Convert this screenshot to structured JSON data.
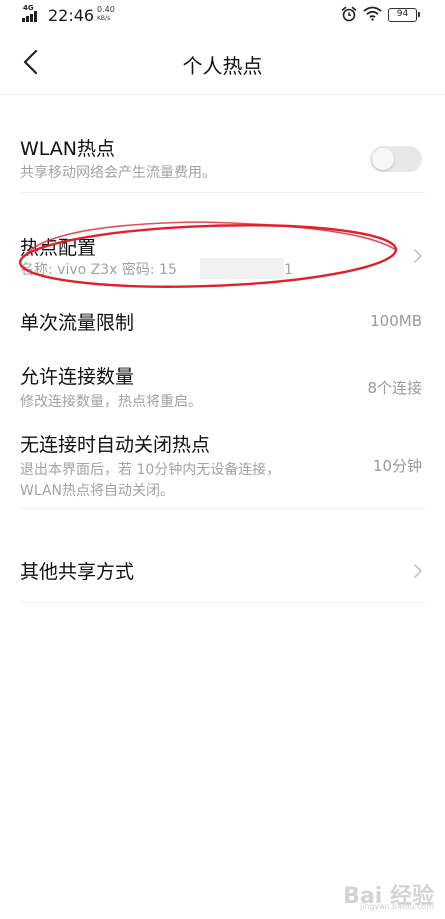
{
  "status_bar": {
    "network": "4G",
    "time": "22:46",
    "speed_value": "0.40",
    "speed_unit": "KB/s",
    "battery": "94",
    "icons": [
      "signal-icon",
      "alarm-icon",
      "wifi-icon",
      "battery-icon"
    ]
  },
  "header": {
    "title": "个人热点",
    "back_icon": "chevron-left-icon"
  },
  "wlan_hotspot": {
    "title": "WLAN热点",
    "subtitle": "共享移动网络会产生流量费用。",
    "enabled": false
  },
  "hotspot_config": {
    "title": "热点配置",
    "name_label": "名称: vivo Z3x  密码: 15",
    "password_tail": "1"
  },
  "data_limit": {
    "title": "单次流量限制",
    "value": "100MB"
  },
  "max_connections": {
    "title": "允许连接数量",
    "subtitle": "修改连接数量，热点将重启。",
    "value": "8个连接"
  },
  "auto_off": {
    "title": "无连接时自动关闭热点",
    "subtitle_line1": "退出本界面后，若 10分钟内无设备连接，",
    "subtitle_line2": "WLAN热点将自动关闭。",
    "value": "10分钟"
  },
  "other_share": {
    "title": "其他共享方式"
  },
  "colors": {
    "annotation_red": "#e0202a",
    "divider": "#efefef",
    "secondary_text": "#a2a2a2"
  },
  "watermark": {
    "text": "Bai 经验",
    "sub": "jingyan.baidu.com"
  }
}
